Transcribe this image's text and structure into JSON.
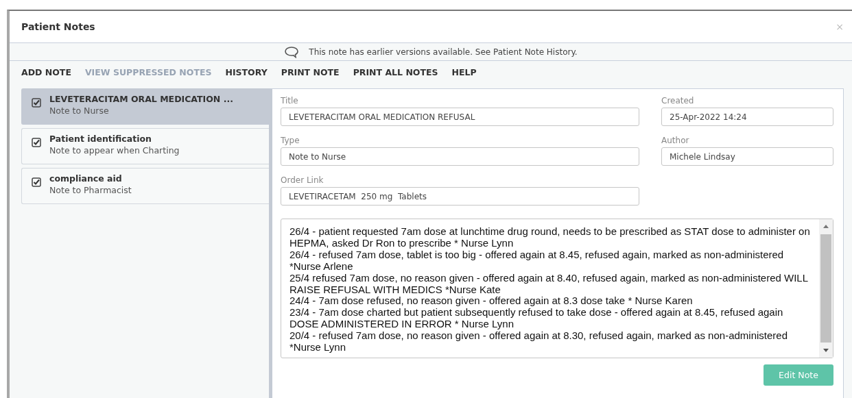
{
  "window": {
    "title": "Patient Notes",
    "close": "×"
  },
  "info_bar": {
    "text": "This note has earlier versions available. See Patient Note History."
  },
  "menu": [
    {
      "label": "ADD NOTE",
      "disabled": false
    },
    {
      "label": "VIEW SUPPRESSED NOTES",
      "disabled": true
    },
    {
      "label": "HISTORY",
      "disabled": false
    },
    {
      "label": "PRINT NOTE",
      "disabled": false
    },
    {
      "label": "PRINT ALL NOTES",
      "disabled": false
    },
    {
      "label": "HELP",
      "disabled": false
    }
  ],
  "notes": [
    {
      "title": "LEVETERACITAM ORAL MEDICATION ...",
      "type": "Note to Nurse",
      "checked": true,
      "selected": true
    },
    {
      "title": "Patient identification",
      "type": "Note to appear when Charting",
      "checked": true,
      "selected": false
    },
    {
      "title": "compliance aid",
      "type": "Note to Pharmacist",
      "checked": true,
      "selected": false
    }
  ],
  "detail": {
    "title": {
      "label": "Title",
      "value": "LEVETERACITAM ORAL MEDICATION REFUSAL"
    },
    "created": {
      "label": "Created",
      "value": "25-Apr-2022 14:24"
    },
    "type": {
      "label": "Type",
      "value": "Note to Nurse"
    },
    "author": {
      "label": "Author",
      "value": "Michele Lindsay"
    },
    "order_link": {
      "label": "Order Link",
      "value": "LEVETIRACETAM  250 mg  Tablets"
    },
    "note_text": [
      "26/4 - patient requested 7am dose at lunchtime drug round, needs to be prescribed as STAT dose to administer on HEPMA, asked Dr Ron to prescribe * Nurse Lynn",
      "26/4 - refused 7am dose, tablet is too big - offered again at 8.45, refused again, marked as non-administered *Nurse Arlene",
      "25/4 refused 7am dose, no reason given - offered again at 8.40, refused again, marked as non-administered WILL RAISE REFUSAL WITH MEDICS *Nurse Kate",
      "24/4 - 7am dose refused, no reason given - offered again at 8.3 dose take * Nurse Karen",
      "23/4 - 7am dose charted but patient subsequently refused to take dose - offered again at 8.45, refused again DOSE ADMINISTERED IN ERROR * Nurse Lynn",
      "20/4 - refused 7am dose, no reason given - offered again at 8.30, refused again, marked as non-administered *Nurse Lynn"
    ],
    "edit_button": "Edit Note"
  }
}
